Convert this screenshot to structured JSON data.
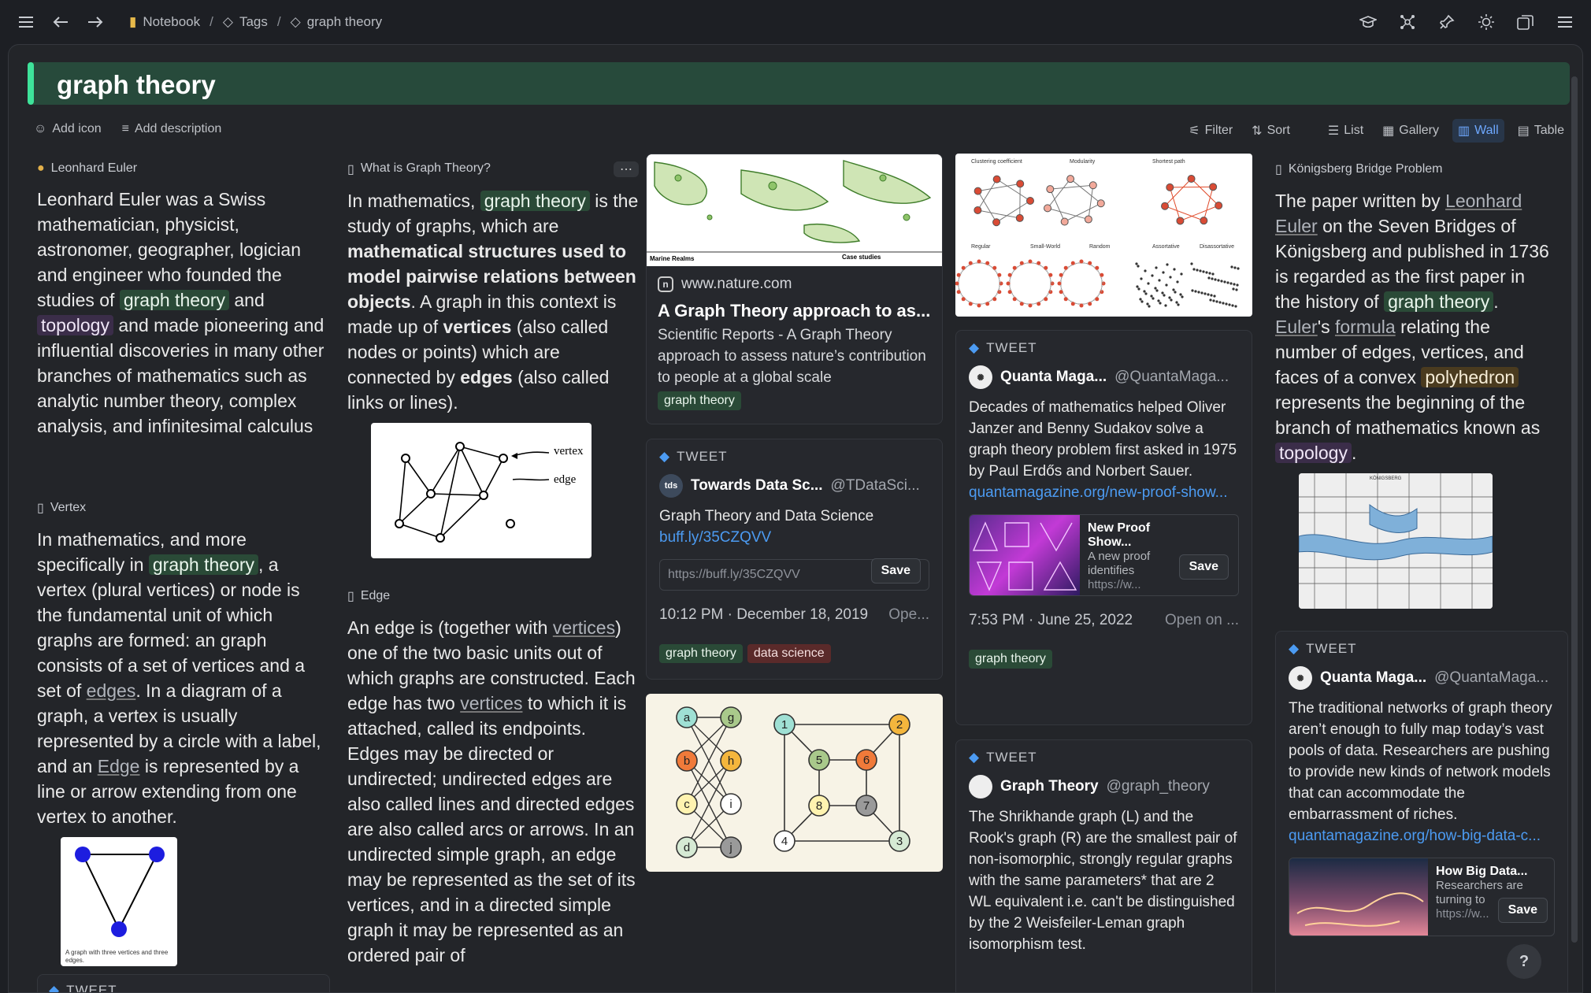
{
  "topbar": {
    "crumbs": [
      "Notebook",
      "Tags",
      "graph theory"
    ]
  },
  "page": {
    "title": "graph theory",
    "add_icon": "Add icon",
    "add_description": "Add description"
  },
  "toolbar": {
    "filter": "Filter",
    "sort": "Sort",
    "list": "List",
    "gallery": "Gallery",
    "wall": "Wall",
    "table": "Table"
  },
  "c1": {
    "euler_title": "Leonhard Euler",
    "euler": [
      "Leonhard Euler was a Swiss mathematician, physicist, astronomer, geographer, logician and engineer who founded the studies of ",
      "graph theory",
      " and ",
      "topology",
      " and made pioneering and influential discoveries in many other branches of mathematics such as analytic number theory, complex analysis, and infinitesimal calculus"
    ],
    "vertex_title": "Vertex",
    "vertex": [
      "In mathematics, and more specifically in ",
      "graph theory",
      ", a vertex (plural vertices) or node is the fundamental unit of which graphs are formed: an graph consists of a set of vertices and a set of ",
      "edges",
      ". In a diagram of a graph, a vertex is usually represented by a circle with a label, and an ",
      "Edge",
      " is represented by a line or arrow extending from one vertex to another."
    ],
    "tri_caption": "A graph with three vertices and three edges.",
    "tweet_label": "TWEET"
  },
  "c2": {
    "what_title": "What is Graph Theory?",
    "what": [
      "In mathematics, ",
      "graph theory",
      " is the study of graphs, which are ",
      "mathematical structures used to model pairwise relations between objects",
      ". A graph in this context is made up of ",
      "vertices",
      " (also called nodes or points) which are connected by ",
      "edges",
      " (also called links or lines)."
    ],
    "fig_vertex": "vertex",
    "fig_edge": "edge",
    "edge_title": "Edge",
    "edge": [
      "An edge is (together with ",
      "vertices",
      ") one of the two basic units out of which graphs are constructed. Each edge has two ",
      "vertices",
      " to which it is attached, called its endpoints. Edges may be directed or undirected; undirected edges are also called lines and directed edges are also called arcs or arrows. In an undirected simple graph, an edge may be represented as the set of its vertices, and in a directed simple graph it may be represented as an ordered pair of"
    ]
  },
  "c3": {
    "map_marine": "Marine Realms",
    "map_case": "Case studies",
    "site": "www.nature.com",
    "link_title": "A Graph Theory approach to as...",
    "link_desc": "Scientific Reports - A Graph Theory approach to assess nature’s contribution to people at a global scale",
    "tag1": "graph theory",
    "tw_label": "TWEET",
    "tw_user": "Towards Data Sc...",
    "tw_handle": "@TDataSci...",
    "tw_text": "Graph Theory and Data Science",
    "tw_link": "buff.ly/35CZQVV",
    "url_ph": "https://buff.ly/35CZQVV",
    "save": "Save",
    "tw_time": "10:12 PM · December 18, 2019",
    "tw_open": "Ope...",
    "tag_a": "graph theory",
    "tag_b": "data science",
    "bip_left": [
      "a",
      "g",
      "b",
      "h",
      "c",
      "i",
      "d",
      "j"
    ],
    "bip_right": [
      "1",
      "2",
      "5",
      "6",
      "8",
      "7",
      "4",
      "3"
    ]
  },
  "c4": {
    "net_labels": [
      "Clustering coefficient",
      "Modularity",
      "Shortest path",
      "Regular",
      "Small-World",
      "Random",
      "Assortative",
      "Disassortative"
    ],
    "tw1_label": "TWEET",
    "tw1_user": "Quanta Maga...",
    "tw1_handle": "@QuantaMaga...",
    "tw1_text": "Decades of mathematics helped Oliver Janzer and Benny Sudakov solve a graph theory problem first asked in 1975 by Paul Erdős and Norbert Sauer.",
    "tw1_link": "quantamagazine.org/new-proof-show...",
    "prev_title": "New Proof Show...",
    "prev_desc": "A new proof identifies",
    "prev_url": "https://w...",
    "save": "Save",
    "tw1_time": "7:53 PM · June 25, 2022",
    "tw1_open": "Open on ...",
    "tw1_tag": "graph theory",
    "tw2_label": "TWEET",
    "tw2_user": "Graph Theory",
    "tw2_handle": "@graph_theory",
    "tw2_text": "The Shrikhande graph (L) and the Rook's graph (R) are the smallest pair of non-isomorphic, strongly regular graphs with the same parameters* that are 2 WL equivalent i.e. can't be distinguished by the 2 Weisfeiler-Leman graph isomorphism test."
  },
  "c5": {
    "kb_title": "Königsberg Bridge Problem",
    "kb": [
      "The paper written by ",
      "Leonhard Euler",
      " on the Seven Bridges of Königsberg and published in 1736 is regarded as the first paper in the history of ",
      "graph theory",
      ". ",
      "Euler",
      "'s ",
      "formula",
      " relating the number of edges, vertices, and faces of a convex ",
      "polyhedron",
      " represents the beginning of the branch of mathematics known as ",
      "topology",
      "."
    ],
    "map_label": "KÖNIGSBERG",
    "tw_label": "TWEET",
    "tw_user": "Quanta Maga...",
    "tw_handle": "@QuantaMaga...",
    "tw_text": "The traditional networks of graph theory aren’t enough to fully map today’s vast pools of data. Researchers are pushing to provide new kinds of network models that can accommodate the embarrassment of riches.",
    "tw_link": "quantamagazine.org/how-big-data-c...",
    "prev_title": "How Big Data...",
    "prev_desc": "Researchers are turning to",
    "prev_url": "https://w...",
    "save": "Save",
    "help": "?"
  }
}
